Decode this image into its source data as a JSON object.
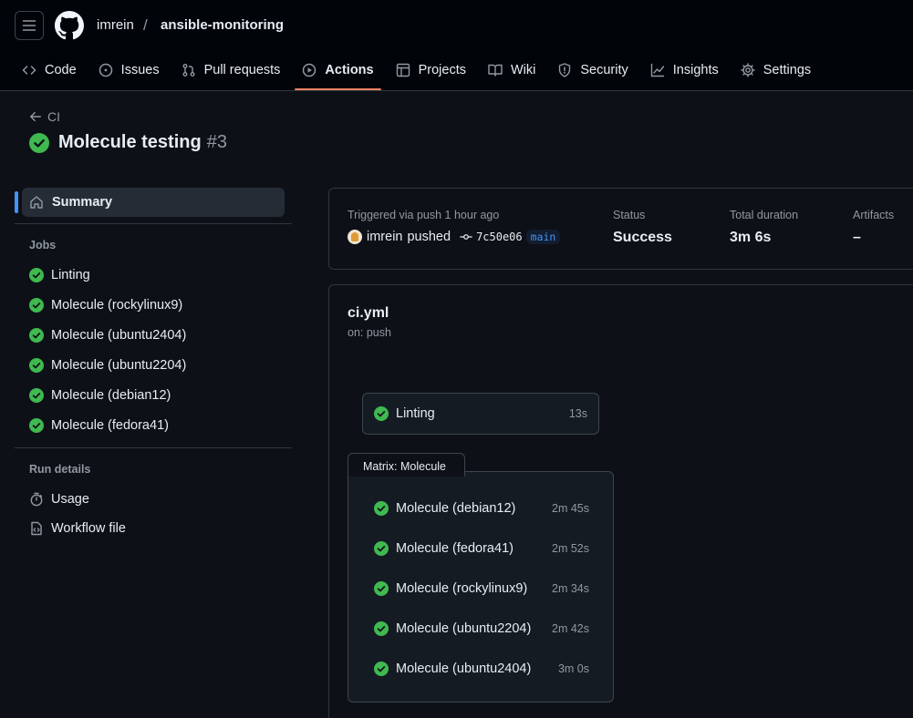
{
  "header": {
    "owner": "imrein",
    "separator": "/",
    "repo": "ansible-monitoring"
  },
  "tabs": [
    {
      "label": "Code",
      "icon": "code-icon"
    },
    {
      "label": "Issues",
      "icon": "issue-icon"
    },
    {
      "label": "Pull requests",
      "icon": "pull-request-icon"
    },
    {
      "label": "Actions",
      "icon": "play-icon",
      "active": true
    },
    {
      "label": "Projects",
      "icon": "table-icon"
    },
    {
      "label": "Wiki",
      "icon": "book-icon"
    },
    {
      "label": "Security",
      "icon": "shield-icon"
    },
    {
      "label": "Insights",
      "icon": "graph-icon"
    },
    {
      "label": "Settings",
      "icon": "gear-icon"
    }
  ],
  "run": {
    "back_label": "CI",
    "title": "Molecule testing",
    "number": "#3"
  },
  "sidebar": {
    "summary_label": "Summary",
    "jobs_heading": "Jobs",
    "jobs": [
      {
        "label": "Linting"
      },
      {
        "label": "Molecule (rockylinux9)"
      },
      {
        "label": "Molecule (ubuntu2404)"
      },
      {
        "label": "Molecule (ubuntu2204)"
      },
      {
        "label": "Molecule (debian12)"
      },
      {
        "label": "Molecule (fedora41)"
      }
    ],
    "run_details_heading": "Run details",
    "usage_label": "Usage",
    "workflow_file_label": "Workflow file"
  },
  "summary": {
    "triggered_text": "Triggered via push 1 hour ago",
    "actor": "imrein",
    "action": "pushed",
    "commit": "7c50e06",
    "branch": "main",
    "status_label": "Status",
    "status_value": "Success",
    "duration_label": "Total duration",
    "duration_value": "3m 6s",
    "artifacts_label": "Artifacts",
    "artifacts_value": "–"
  },
  "workflow": {
    "file": "ci.yml",
    "trigger": "on: push",
    "linting": {
      "name": "Linting",
      "duration": "13s"
    },
    "matrix_label": "Matrix: Molecule",
    "matrix_jobs": [
      {
        "name": "Molecule (debian12)",
        "duration": "2m 45s"
      },
      {
        "name": "Molecule (fedora41)",
        "duration": "2m 52s"
      },
      {
        "name": "Molecule (rockylinux9)",
        "duration": "2m 34s"
      },
      {
        "name": "Molecule (ubuntu2204)",
        "duration": "2m 42s"
      },
      {
        "name": "Molecule (ubuntu2404)",
        "duration": "3m 0s"
      }
    ]
  },
  "colors": {
    "success": "#3fb950",
    "accent": "#4493f8",
    "tab_underline": "#f78166"
  }
}
